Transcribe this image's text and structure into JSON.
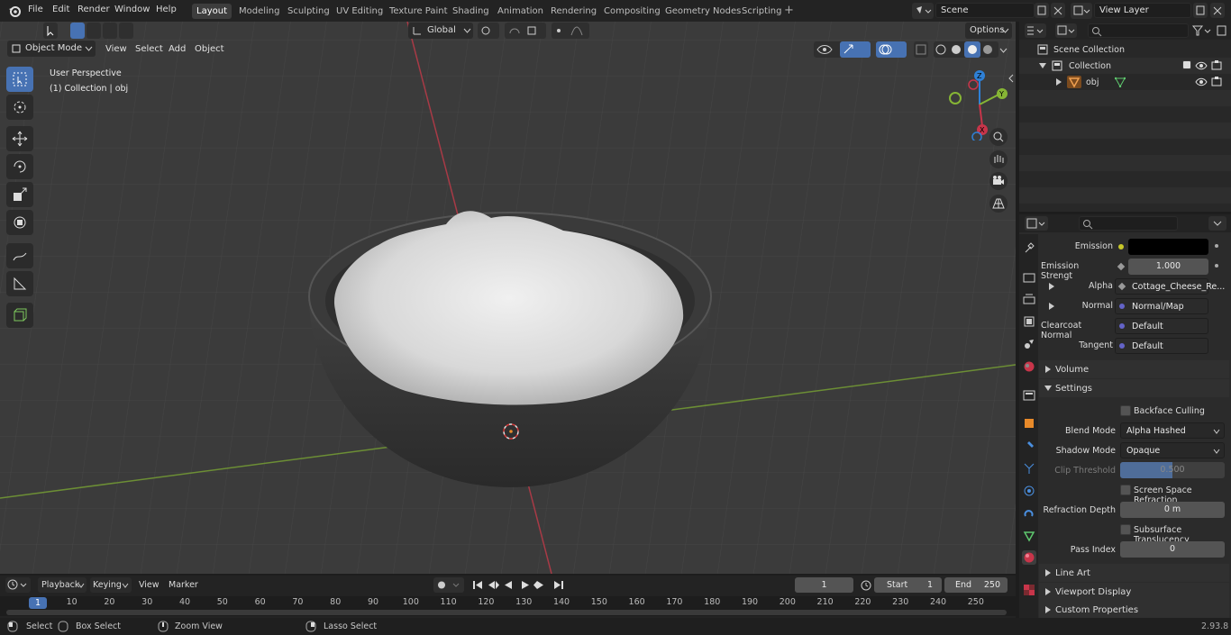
{
  "menu": [
    "File",
    "Edit",
    "Render",
    "Window",
    "Help"
  ],
  "workspaces": [
    "Layout",
    "Modeling",
    "Sculpting",
    "UV Editing",
    "Texture Paint",
    "Shading",
    "Animation",
    "Rendering",
    "Compositing",
    "Geometry Nodes",
    "Scripting"
  ],
  "scene": {
    "name": "Scene",
    "view_layer": "View Layer"
  },
  "viewport": {
    "mode": "Object Mode",
    "menus": [
      "View",
      "Select",
      "Add",
      "Object"
    ],
    "transform": "Global",
    "options": "Options",
    "overlay_title": "User Perspective",
    "overlay_subtitle": "(1) Collection | obj",
    "gizmo": {
      "z": "Z",
      "y": "Y",
      "x": "X"
    }
  },
  "outliner": {
    "root": "Scene Collection",
    "collection": "Collection",
    "object": "obj"
  },
  "properties": {
    "rows": [
      {
        "label": "Emission",
        "value": ""
      },
      {
        "label": "Emission Strengt",
        "value": "1.000"
      },
      {
        "label": "Alpha",
        "value": "Cottage_Cheese_Re..."
      },
      {
        "label": "Normal",
        "value": "Normal/Map"
      },
      {
        "label": "Clearcoat Normal",
        "value": "Default"
      },
      {
        "label": "Tangent",
        "value": "Default"
      }
    ],
    "volume": "Volume",
    "settings": "Settings",
    "backface": "Backface Culling",
    "blend_label": "Blend Mode",
    "blend_value": "Alpha Hashed",
    "shadow_label": "Shadow Mode",
    "shadow_value": "Opaque",
    "clip_label": "Clip Threshold",
    "clip_value": "0.500",
    "clip_fraction": 0.5,
    "ssr": "Screen Space Refraction",
    "refr_label": "Refraction Depth",
    "refr_value": "0 m",
    "sss": "Subsurface Translucency",
    "pass_label": "Pass Index",
    "pass_value": "0",
    "line_art": "Line Art",
    "viewport_display": "Viewport Display",
    "custom_props": "Custom Properties"
  },
  "timeline": {
    "menus": [
      "Playback",
      "Keying",
      "View",
      "Marker"
    ],
    "current_frame": "1",
    "start_label": "Start",
    "start": "1",
    "end_label": "End",
    "end": "250",
    "ticks": [
      "1",
      "10",
      "20",
      "30",
      "40",
      "50",
      "60",
      "70",
      "80",
      "90",
      "100",
      "110",
      "120",
      "130",
      "140",
      "150",
      "160",
      "170",
      "180",
      "190",
      "200",
      "210",
      "220",
      "230",
      "240",
      "250"
    ]
  },
  "status": {
    "select": "Select",
    "box_select": "Box Select",
    "zoom_view": "Zoom View",
    "lasso_select": "Lasso Select",
    "version": "2.93.8"
  },
  "colors": {
    "accent": "#4772b3",
    "x_axis": "#c8354a",
    "y_axis": "#86b535",
    "z_axis": "#2e80d6",
    "selected": "#e88a2a"
  }
}
